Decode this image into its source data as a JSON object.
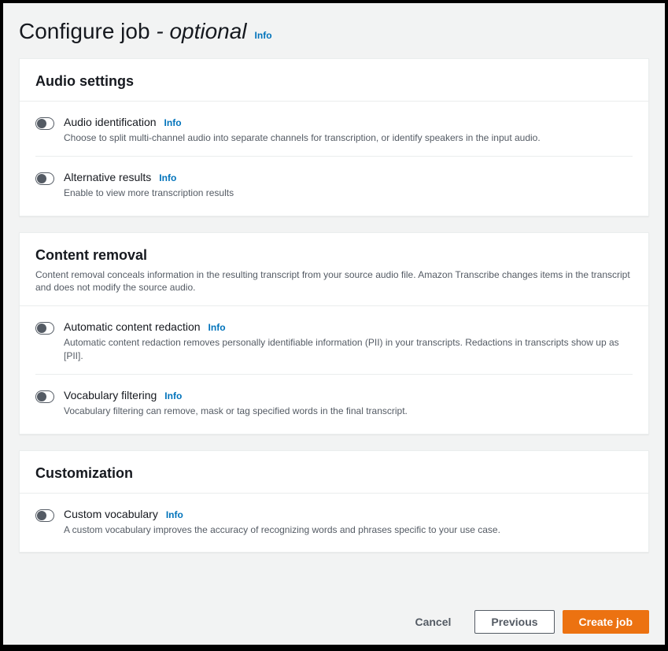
{
  "header": {
    "title_prefix": "Configure job",
    "title_suffix": "- optional",
    "info": "Info"
  },
  "sections": {
    "audio": {
      "title": "Audio settings",
      "items": [
        {
          "label": "Audio identification",
          "info": "Info",
          "desc": "Choose to split multi-channel audio into separate channels for transcription, or identify speakers in the input audio."
        },
        {
          "label": "Alternative results",
          "info": "Info",
          "desc": "Enable to view more transcription results"
        }
      ]
    },
    "content_removal": {
      "title": "Content removal",
      "desc": "Content removal conceals information in the resulting transcript from your source audio file. Amazon Transcribe changes items in the transcript and does not modify the source audio.",
      "items": [
        {
          "label": "Automatic content redaction",
          "info": "Info",
          "desc": "Automatic content redaction removes personally identifiable information (PII) in your transcripts. Redactions in transcripts show up as [PII]."
        },
        {
          "label": "Vocabulary filtering",
          "info": "Info",
          "desc": "Vocabulary filtering can remove, mask or tag specified words in the final transcript."
        }
      ]
    },
    "customization": {
      "title": "Customization",
      "items": [
        {
          "label": "Custom vocabulary",
          "info": "Info",
          "desc": "A custom vocabulary improves the accuracy of recognizing words and phrases specific to your use case."
        }
      ]
    }
  },
  "footer": {
    "cancel": "Cancel",
    "previous": "Previous",
    "create": "Create job"
  }
}
